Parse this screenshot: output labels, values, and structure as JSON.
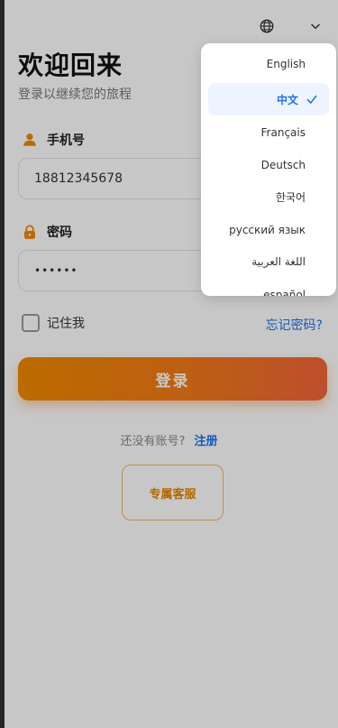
{
  "header": {
    "language_icon": "globe-icon",
    "dropdown_icon": "chevron-down-icon"
  },
  "page": {
    "title": "欢迎回来",
    "subtitle": "登录以继续您的旅程"
  },
  "form": {
    "phone_label": "手机号",
    "phone_icon": "user-icon",
    "phone_value": "18812345678",
    "password_label": "密码",
    "password_icon": "lock-icon",
    "password_value": "••••••",
    "remember_label": "记住我",
    "forgot_label": "忘记密码?",
    "login_label": "登录"
  },
  "signup": {
    "prompt": "还没有账号?",
    "link": "注册"
  },
  "service": {
    "label": "专属客服"
  },
  "language_menu": {
    "items": [
      {
        "label": "English",
        "selected": false
      },
      {
        "label": "中文",
        "selected": true
      },
      {
        "label": "Français",
        "selected": false
      },
      {
        "label": "Deutsch",
        "selected": false
      },
      {
        "label": "한국어",
        "selected": false
      },
      {
        "label": "русский язык",
        "selected": false
      },
      {
        "label": "اللغة العربية",
        "selected": false
      },
      {
        "label": "español",
        "selected": false
      }
    ]
  },
  "colors": {
    "accent": "#f08a00",
    "link": "#1a73e8"
  }
}
